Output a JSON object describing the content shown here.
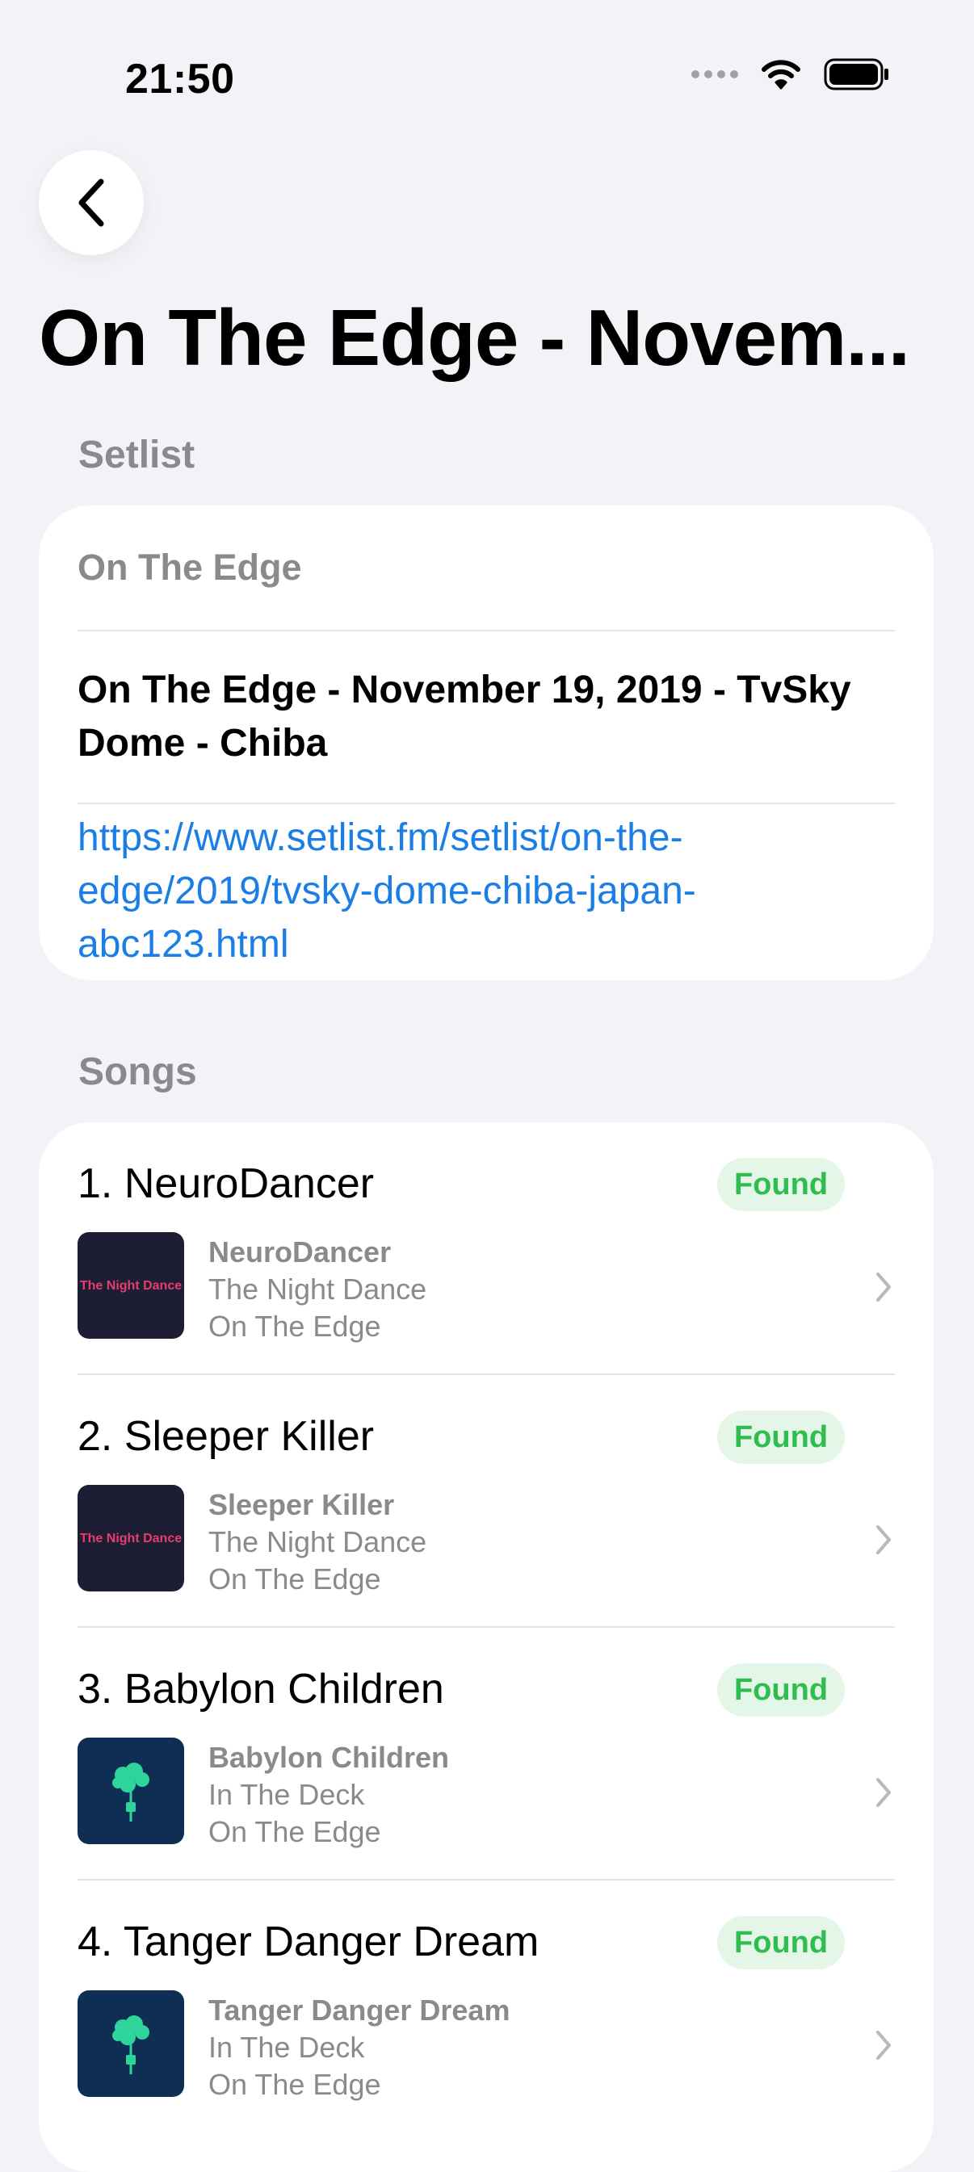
{
  "status": {
    "time": "21:50"
  },
  "nav": {
    "title": "On The Edge - Novem..."
  },
  "setlist_section": {
    "header": "Setlist",
    "artist": "On The Edge",
    "title": "On The Edge - November 19, 2019 - TvSky Dome - Chiba",
    "url": "https://www.setlist.fm/setlist/on-the-edge/2019/tvsky-dome-chiba-japan-abc123.html"
  },
  "songs_section": {
    "header": "Songs",
    "items": [
      {
        "title": "1. NeuroDancer",
        "badge": "Found",
        "track": "NeuroDancer",
        "album": "The Night Dance",
        "artist": "On The Edge",
        "art_text": "The Night Dance",
        "art_type": "night-dance"
      },
      {
        "title": "2. Sleeper Killer",
        "badge": "Found",
        "track": "Sleeper Killer",
        "album": "The Night Dance",
        "artist": "On The Edge",
        "art_text": "The Night Dance",
        "art_type": "night-dance"
      },
      {
        "title": "3. Babylon Children",
        "badge": "Found",
        "track": "Babylon Children",
        "album": "In The Deck",
        "artist": "On The Edge",
        "art_type": "in-the-deck"
      },
      {
        "title": "4. Tanger Danger Dream",
        "badge": "Found",
        "track": "Tanger Danger Dream",
        "album": "In The Deck",
        "artist": "On The Edge",
        "art_type": "in-the-deck"
      }
    ]
  },
  "colors": {
    "background": "#f2f2f7",
    "link": "#1a7ee6",
    "found_text": "#2fbd4f",
    "found_bg": "#e3f6e7",
    "secondary_text": "#8a8a8e"
  }
}
